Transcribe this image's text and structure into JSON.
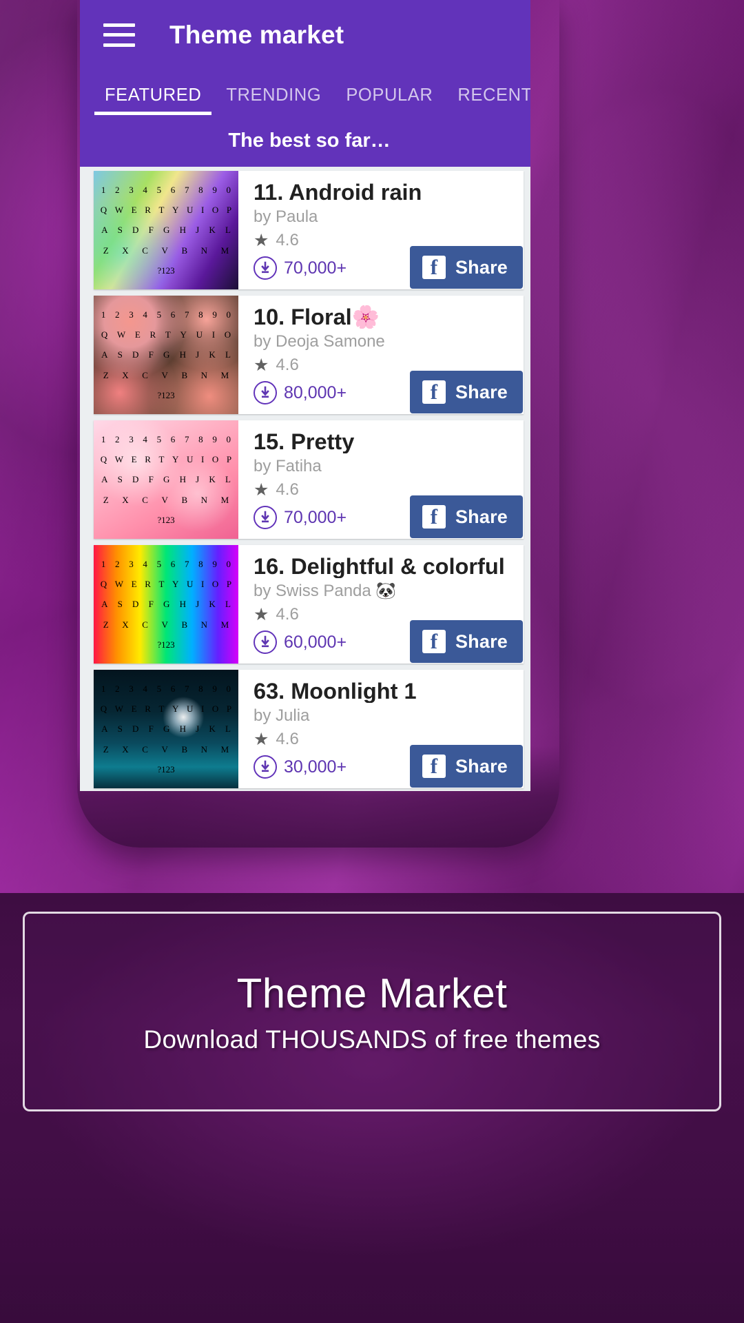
{
  "appbar": {
    "menu_icon": "hamburger-menu-icon",
    "title": "Theme market"
  },
  "tabs": [
    {
      "label": "FEATURED",
      "active": true
    },
    {
      "label": "TRENDING",
      "active": false
    },
    {
      "label": "POPULAR",
      "active": false
    },
    {
      "label": "RECENT",
      "active": false
    }
  ],
  "section": {
    "banner_title": "The best so far…"
  },
  "themes": [
    {
      "title": "11. Android rain",
      "author": "by Paula",
      "rating": "4.6",
      "downloads": "70,000+",
      "share_label": "Share",
      "thumb_class": "th-rain",
      "kb_rows": [
        "1 2 3 4 5 6 7 8 9 0",
        "Q W E R T Y U I O P",
        "A S D F G H J K L",
        "Z X C V B N M",
        "?123"
      ]
    },
    {
      "title": "10. Floral🌸",
      "author": "by Deoja Samone",
      "rating": "4.6",
      "downloads": "80,000+",
      "share_label": "Share",
      "thumb_class": "th-floral",
      "kb_rows": [
        "1 2 3 4 5 6 7 8 9 0",
        "Q W E R T Y U I O",
        "A S D F G H J K L",
        "Z X C V B N M",
        "?123"
      ]
    },
    {
      "title": "15. Pretty",
      "author": "by Fatiha",
      "rating": "4.6",
      "downloads": "70,000+",
      "share_label": "Share",
      "thumb_class": "th-pretty",
      "kb_rows": [
        "1 2 3 4 5 6 7 8 9 0",
        "Q W E R T Y U I O P",
        "A S D F G H J K L",
        "Z X C V B N M",
        "?123"
      ]
    },
    {
      "title": "16. Delightful & colorful",
      "author": "by Swiss Panda 🐼",
      "rating": "4.6",
      "downloads": "60,000+",
      "share_label": "Share",
      "thumb_class": "th-colorful",
      "kb_rows": [
        "1 2 3 4 5 6 7 8 9 0",
        "Q W E R T Y U I O P",
        "A S D F G H J K L",
        "Z X C V B N M",
        "?123"
      ]
    },
    {
      "title": "63. Moonlight 1",
      "author": "by Julia",
      "rating": "4.6",
      "downloads": "30,000+",
      "share_label": "Share",
      "thumb_class": "th-moon",
      "kb_rows": [
        "1 2 3 4 5 6 7 8 9 0",
        "Q W E R T Y U I O P",
        "A S D F G H J K L",
        "Z X C V B N M",
        "?123"
      ]
    }
  ],
  "promo": {
    "title": "Theme Market",
    "subtitle": "Download  THOUSANDS  of free themes"
  },
  "colors": {
    "primary": "#6233ba",
    "facebook_blue": "#3b5998",
    "download_purple": "#5e35b1",
    "list_background": "#eceff1"
  }
}
